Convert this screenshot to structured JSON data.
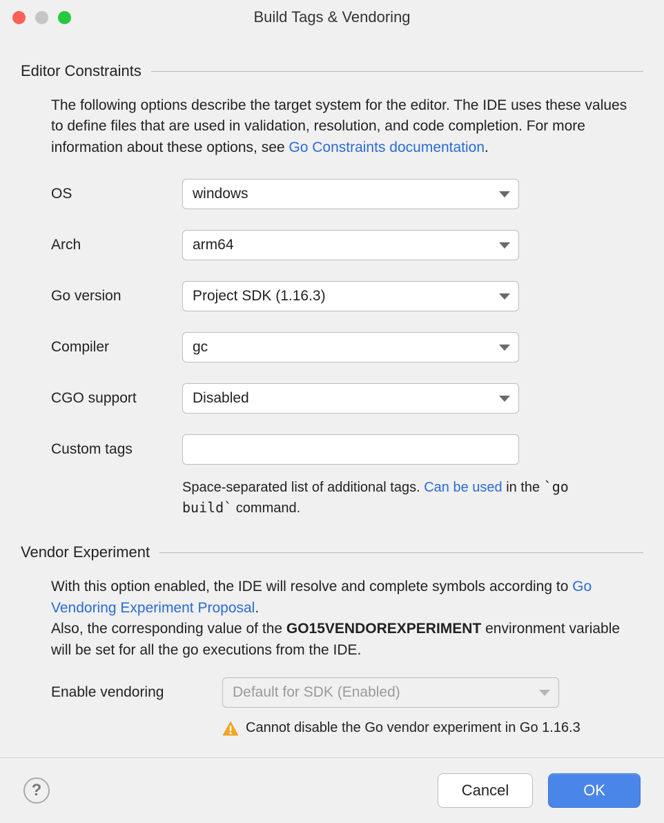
{
  "window": {
    "title": "Build Tags & Vendoring"
  },
  "sections": {
    "editor_constraints": {
      "title": "Editor Constraints",
      "description_pre": "The following options describe the target system for the editor. The IDE uses these values to define files that are used in validation, resolution, and code completion. For more information about these options, see ",
      "description_link": "Go Constraints documentation",
      "description_post": ".",
      "fields": {
        "os": {
          "label": "OS",
          "value": "windows"
        },
        "arch": {
          "label": "Arch",
          "value": "arm64"
        },
        "go_version": {
          "label": "Go version",
          "value": "Project SDK (1.16.3)"
        },
        "compiler": {
          "label": "Compiler",
          "value": "gc"
        },
        "cgo_support": {
          "label": "CGO support",
          "value": "Disabled"
        },
        "custom_tags": {
          "label": "Custom tags",
          "value": ""
        }
      },
      "custom_tags_help_pre": "Space-separated list of additional tags. ",
      "custom_tags_help_link": "Can be used",
      "custom_tags_help_post_a": " in the ",
      "custom_tags_help_code": "`go build`",
      "custom_tags_help_post_b": " command."
    },
    "vendor_experiment": {
      "title": "Vendor Experiment",
      "desc1_pre": "With this option enabled, the IDE will resolve and complete symbols according to ",
      "desc1_link": "Go Vendoring Experiment Proposal",
      "desc1_post": ".",
      "desc2_pre": "Also, the corresponding value of the ",
      "desc2_bold": "GO15VENDOREXPERIMENT",
      "desc2_post": " environment variable will be set for all the go executions from the IDE.",
      "enable_vendoring": {
        "label": "Enable vendoring",
        "value": "Default for SDK (Enabled)"
      },
      "warning": "Cannot disable the Go vendor experiment in Go 1.16.3"
    }
  },
  "footer": {
    "help": "?",
    "cancel": "Cancel",
    "ok": "OK"
  }
}
